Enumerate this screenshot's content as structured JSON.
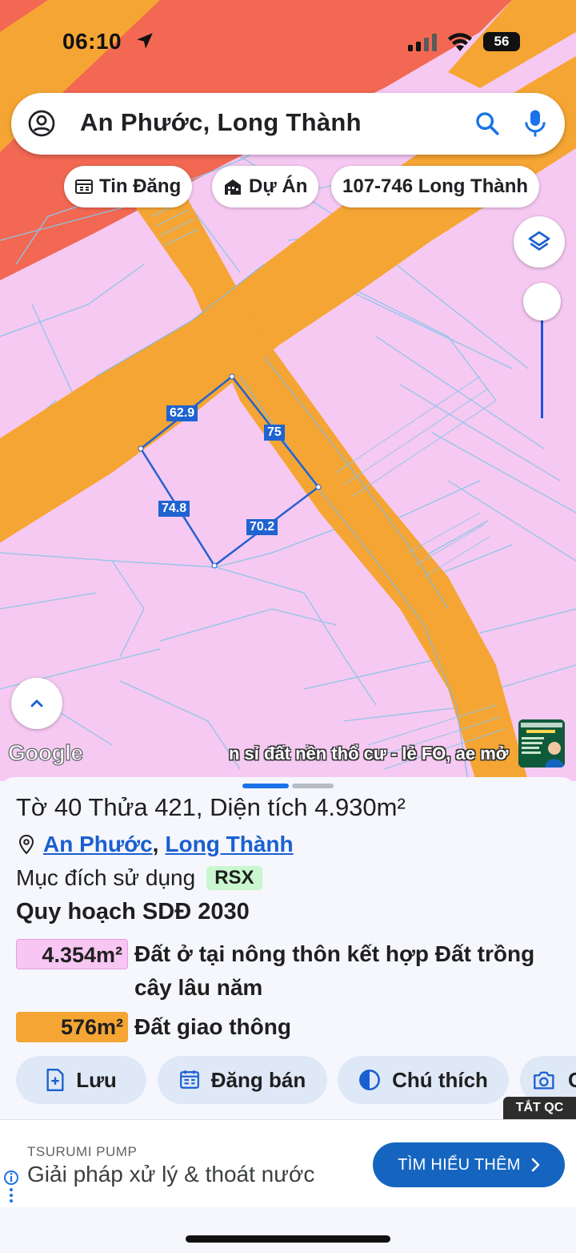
{
  "status": {
    "time": "06:10",
    "battery": "56"
  },
  "search": {
    "query": "An Phước, Long Thành"
  },
  "chips": [
    {
      "label": "Tin Đăng"
    },
    {
      "label": "Dự Án"
    },
    {
      "label": "107-746 Long Thành"
    }
  ],
  "map": {
    "measurements": [
      "62.9",
      "75",
      "74.8",
      "70.2"
    ],
    "logo": "Google",
    "ticker": "n sỉ đất nền thổ cư - lẻ FO, ae mở",
    "zoom_level": 0.85
  },
  "parcel": {
    "title": "Tờ 40 Thửa 421, Diện tích 4.930m²",
    "ward": "An Phước",
    "district": "Long Thành",
    "purpose_label": "Mục đích sử dụng",
    "purpose_code": "RSX",
    "plan_title": "Quy hoạch SDĐ 2030",
    "zones": [
      {
        "area": "4.354m²",
        "desc": "Đất ở tại nông thôn kết hợp Đất trồng cây lâu năm",
        "color": "#f7c6f3"
      },
      {
        "area": "576m²",
        "desc": "Đất giao thông",
        "color": "#f5a533"
      }
    ]
  },
  "actions": [
    {
      "label": "Lưu"
    },
    {
      "label": "Đăng bán"
    },
    {
      "label": "Chú thích"
    },
    {
      "label": "C"
    }
  ],
  "ad": {
    "close_label": "TẮT QC",
    "brand": "TSURUMI PUMP",
    "headline": "Giải pháp xử lý & thoát nước",
    "cta": "TÌM HIỂU THÊM"
  },
  "colors": {
    "residential": "#f6c9f2",
    "road": "#f5a533",
    "zone_red": "#f26852",
    "accent": "#1a73e8"
  }
}
